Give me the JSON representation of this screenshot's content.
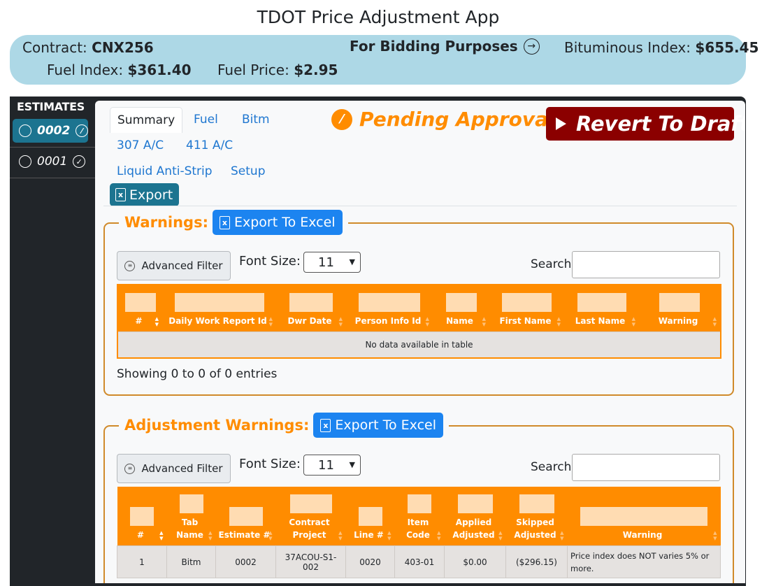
{
  "app": {
    "title": "TDOT Price Adjustment App"
  },
  "banner": {
    "contract_label": "Contract:",
    "contract_value": "CNX256",
    "bidding_text": "For Bidding Purposes",
    "bituminous_label": "Bituminous Index:",
    "bituminous_value": "$655.45",
    "fuel_index_label": "Fuel Index:",
    "fuel_index_value": "$361.40",
    "fuel_price_label": "Fuel Price:",
    "fuel_price_value": "$2.95"
  },
  "sidebar": {
    "title": "ESTIMATES",
    "items": [
      {
        "label": "0002",
        "status_icon": "pending-icon",
        "active": true
      },
      {
        "label": "0001",
        "status_icon": "check-icon",
        "active": false
      }
    ]
  },
  "tabs": {
    "items": [
      "Summary",
      "Fuel",
      "Bitm",
      "307 A/C",
      "411 A/C",
      "Liquid Anti-Strip",
      "Setup"
    ],
    "active": "Summary",
    "export_label": "Export"
  },
  "status": {
    "text": "Pending Approval",
    "color": "#ff8c00"
  },
  "revert": {
    "label": "Revert To Draft",
    "color": "#8b0000"
  },
  "warnings": {
    "title": "Warnings:",
    "excel_label": "Export To Excel",
    "filter_label": "Advanced Filter",
    "font_size_label": "Font Size:",
    "font_size_value": "11",
    "search_label": "Search:",
    "columns": [
      "#",
      "Daily Work Report Id",
      "Dwr Date",
      "Person Info Id",
      "Name",
      "First Name",
      "Last Name",
      "Warning"
    ],
    "empty_text": "No data available in table",
    "showing": "Showing 0 to 0 of 0 entries"
  },
  "adjustment_warnings": {
    "title": "Adjustment Warnings:",
    "excel_label": "Export To Excel",
    "filter_label": "Advanced Filter",
    "font_size_label": "Font Size:",
    "font_size_value": "11",
    "search_label": "Search:",
    "columns": [
      "#",
      "Tab Name",
      "Estimate #",
      "Contract Project",
      "Line #",
      "Item Code",
      "Applied Adjusted",
      "Skipped Adjusted",
      "Warning"
    ],
    "rows": [
      [
        "1",
        "Bitm",
        "0002",
        "37ACOU-S1-002",
        "0020",
        "403-01",
        "$0.00",
        "($296.15)",
        "Price index does NOT varies 5% or more."
      ]
    ]
  },
  "colors": {
    "accent": "#ff8c00",
    "banner": "#add8e6",
    "teal": "#1c7490",
    "excel_blue": "#1c84f0"
  }
}
